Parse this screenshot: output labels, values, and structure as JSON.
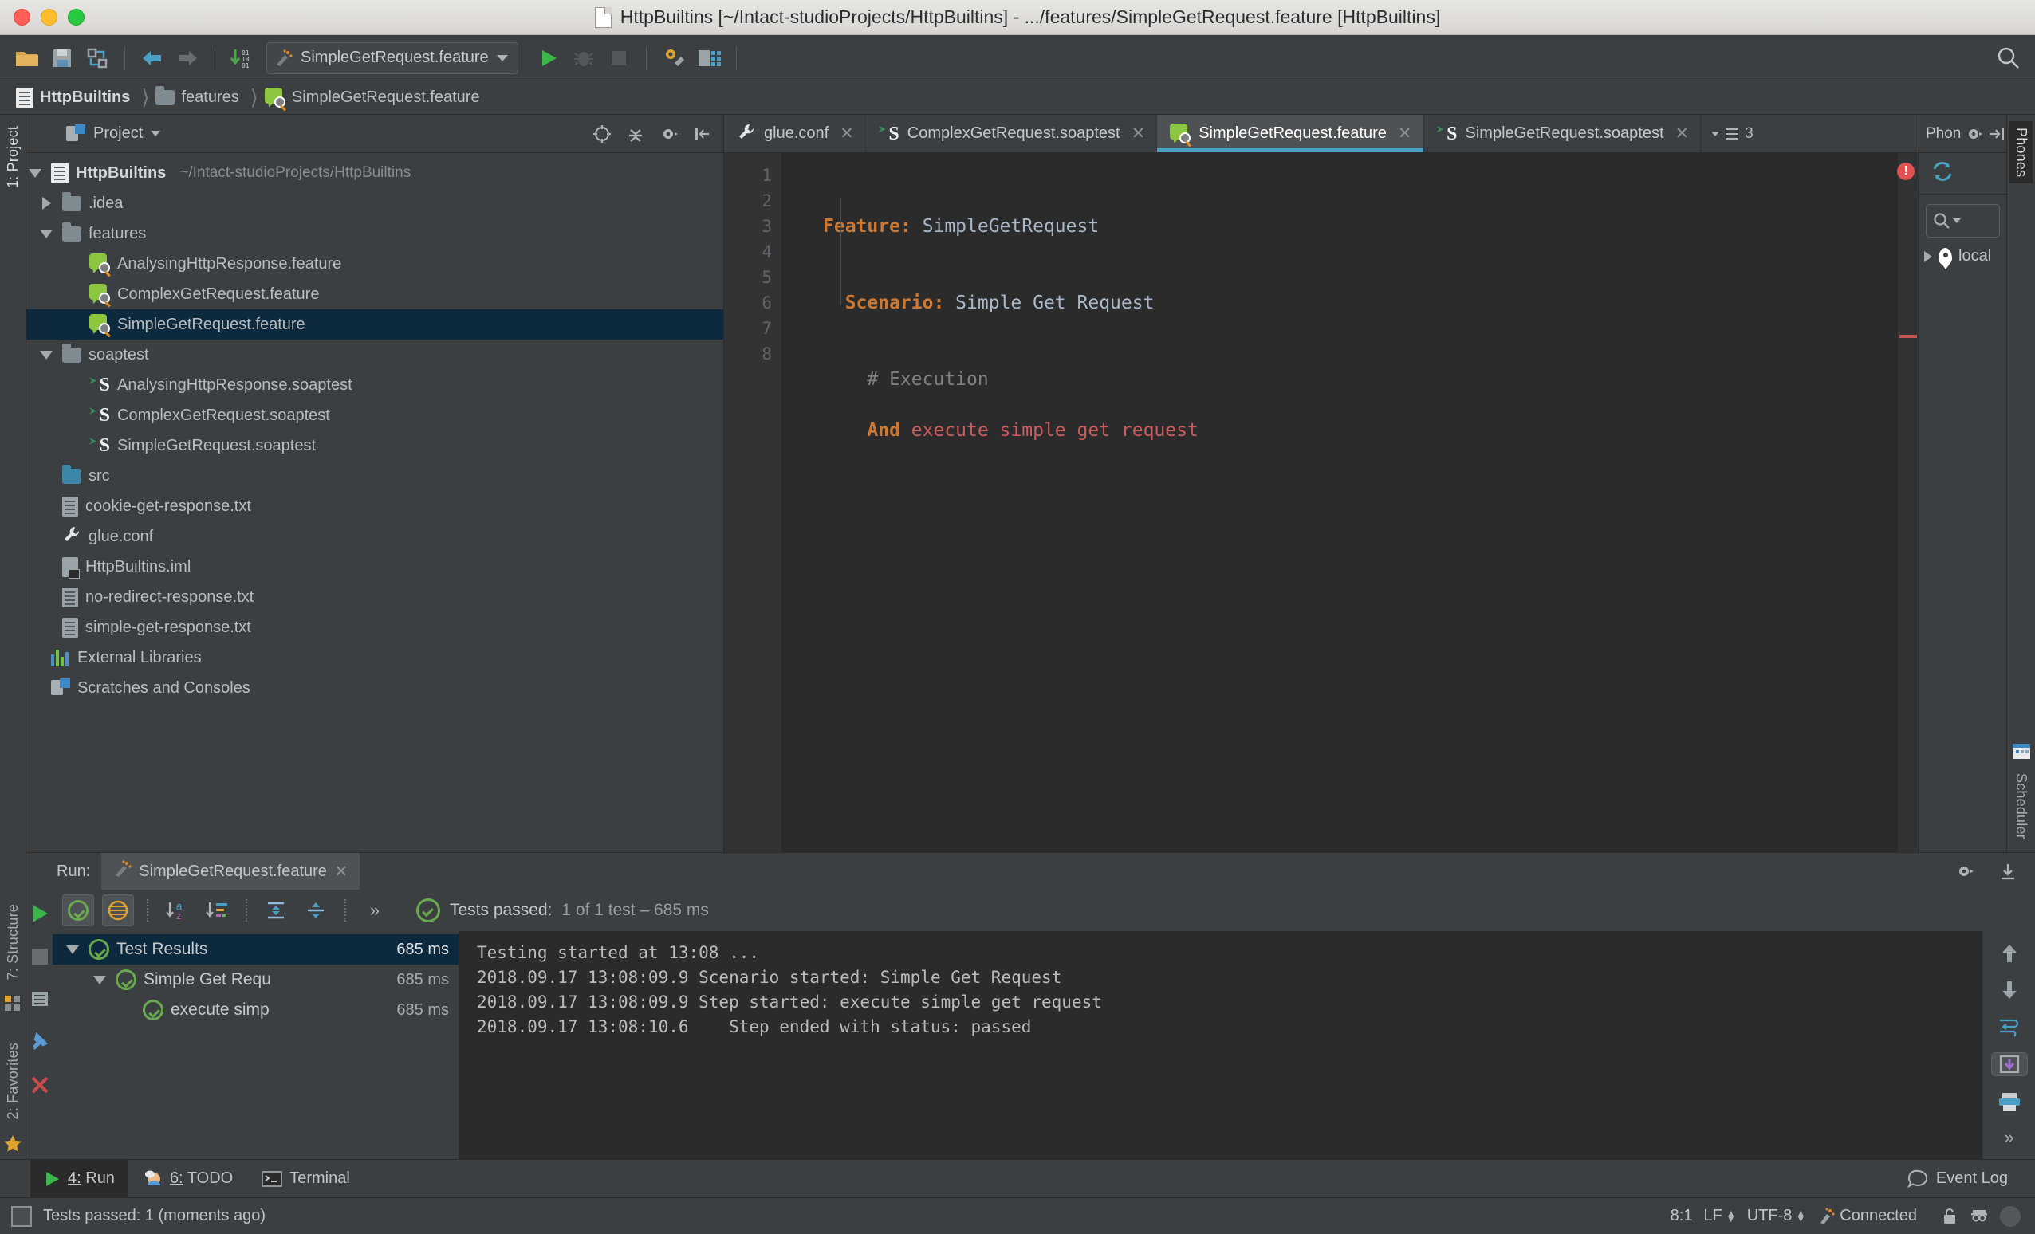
{
  "window": {
    "title": "HttpBuiltins [~/Intact-studioProjects/HttpBuiltins] - .../features/SimpleGetRequest.feature [HttpBuiltins]"
  },
  "toolbar": {
    "run_config": "SimpleGetRequest.feature",
    "icons": [
      "open-folder-icon",
      "save-all-icon",
      "sync-icon",
      "back-icon",
      "forward-icon",
      "update-icon",
      "run-icon",
      "debug-icon",
      "stop-icon",
      "settings-icon",
      "project-structure-icon",
      "search-everywhere-icon"
    ]
  },
  "breadcrumb": {
    "items": [
      {
        "label": "HttpBuiltins",
        "icon": "project-icon"
      },
      {
        "label": "features",
        "icon": "folder-icon"
      },
      {
        "label": "SimpleGetRequest.feature",
        "icon": "cucumber-icon"
      }
    ]
  },
  "left_strip": {
    "project_tab": "1: Project",
    "structure_tab": "7: Structure",
    "favorites_tab": "2: Favorites"
  },
  "project_panel": {
    "title": "Project",
    "tree": [
      {
        "label": "HttpBuiltins",
        "path": "~/Intact-studioProjects/HttpBuiltins",
        "icon": "project-icon",
        "indent": 0,
        "twisty": "down",
        "bold": true
      },
      {
        "label": ".idea",
        "icon": "folder-icon",
        "indent": 1,
        "twisty": "right"
      },
      {
        "label": "features",
        "icon": "folder-icon",
        "indent": 1,
        "twisty": "down"
      },
      {
        "label": "AnalysingHttpResponse.feature",
        "icon": "cucumber-icon",
        "indent": 2
      },
      {
        "label": "ComplexGetRequest.feature",
        "icon": "cucumber-icon",
        "indent": 2
      },
      {
        "label": "SimpleGetRequest.feature",
        "icon": "cucumber-icon",
        "indent": 2,
        "selected": true
      },
      {
        "label": "soaptest",
        "icon": "folder-icon",
        "indent": 1,
        "twisty": "down"
      },
      {
        "label": "AnalysingHttpResponse.soaptest",
        "icon": "soaptest-icon",
        "indent": 2
      },
      {
        "label": "ComplexGetRequest.soaptest",
        "icon": "soaptest-icon",
        "indent": 2
      },
      {
        "label": "SimpleGetRequest.soaptest",
        "icon": "soaptest-icon",
        "indent": 2
      },
      {
        "label": "src",
        "icon": "folder-blue-icon",
        "indent": 1
      },
      {
        "label": "cookie-get-response.txt",
        "icon": "text-file-icon",
        "indent": 1
      },
      {
        "label": "glue.conf",
        "icon": "wrench-icon",
        "indent": 1
      },
      {
        "label": "HttpBuiltins.iml",
        "icon": "module-file-icon",
        "indent": 1
      },
      {
        "label": "no-redirect-response.txt",
        "icon": "text-file-icon",
        "indent": 1
      },
      {
        "label": "simple-get-response.txt",
        "icon": "text-file-icon",
        "indent": 1
      },
      {
        "label": "External Libraries",
        "icon": "external-libraries-icon",
        "indent": 0
      },
      {
        "label": "Scratches and Consoles",
        "icon": "scratches-icon",
        "indent": 0
      }
    ]
  },
  "editor": {
    "tabs": [
      {
        "label": "glue.conf",
        "icon": "wrench-icon",
        "active": false
      },
      {
        "label": "ComplexGetRequest.soaptest",
        "icon": "soaptest-icon",
        "active": false
      },
      {
        "label": "SimpleGetRequest.feature",
        "icon": "cucumber-icon",
        "active": true
      },
      {
        "label": "SimpleGetRequest.soaptest",
        "icon": "soaptest-icon",
        "active": false
      }
    ],
    "tab_overflow_count": "3",
    "line_numbers": [
      "1",
      "2",
      "3",
      "4",
      "5",
      "6",
      "7",
      "8"
    ],
    "code": {
      "l1_kw": "Feature:",
      "l1_val": " SimpleGetRequest",
      "l3_kw": "Scenario:",
      "l3_val": " Simple Get Request",
      "l5_comment": "# Execution",
      "l6_kw": "And",
      "l6_step": " execute simple get request"
    }
  },
  "right_panel": {
    "title": "Phon",
    "vertical_tab": "Phones",
    "scheduler_tab": "Scheduler",
    "search_placeholder": "",
    "items": [
      {
        "label": "local",
        "icon": "location-pin-icon"
      }
    ]
  },
  "run_panel": {
    "label": "Run:",
    "tab_title": "SimpleGetRequest.feature",
    "status": {
      "prefix": "Tests passed:",
      "detail": "1 of 1 test – 685 ms"
    },
    "tree": [
      {
        "label": "Test Results",
        "duration": "685 ms",
        "indent": 0,
        "twisty": "down",
        "selected": true
      },
      {
        "label": "Simple Get Requ",
        "duration": "685 ms",
        "indent": 1,
        "twisty": "down"
      },
      {
        "label": "execute simp",
        "duration": "685 ms",
        "indent": 2
      }
    ],
    "console": "Testing started at 13:08 ...\n2018.09.17 13:08:09.9 Scenario started: Simple Get Request\n2018.09.17 13:08:09.9 Step started: execute simple get request\n2018.09.17 13:08:10.6    Step ended with status: passed",
    "toolbar_icons": [
      "rerun-icon",
      "stop-icon",
      "show-passed-icon",
      "show-ignored-icon",
      "sort-alphabetically-icon",
      "sort-by-duration-icon",
      "expand-all-icon",
      "collapse-all-icon",
      "more-icon"
    ],
    "side_icons": [
      "scroll-up-icon",
      "scroll-down-icon",
      "wrap-text-icon",
      "scroll-to-end-icon",
      "print-icon",
      "expand-icon"
    ]
  },
  "bottom_bar": {
    "items": [
      {
        "label_num": "4:",
        "label": " Run",
        "icon": "run-icon",
        "active": true
      },
      {
        "label_num": "6:",
        "label": " TODO",
        "icon": "todo-icon",
        "active": false
      },
      {
        "label_num": "",
        "label": "Terminal",
        "icon": "terminal-icon",
        "active": false
      }
    ],
    "event_log": "Event Log"
  },
  "status_bar": {
    "message": "Tests passed: 1 (moments ago)",
    "caret": "8:1",
    "line_sep": "LF",
    "encoding": "UTF-8",
    "connection": "Connected"
  },
  "colors": {
    "accent": "#4a9fc4",
    "selection": "#0d293e",
    "keyword": "#cc7832",
    "step": "#cc5c5c",
    "pass": "#6aa84f",
    "error": "#e05252"
  }
}
